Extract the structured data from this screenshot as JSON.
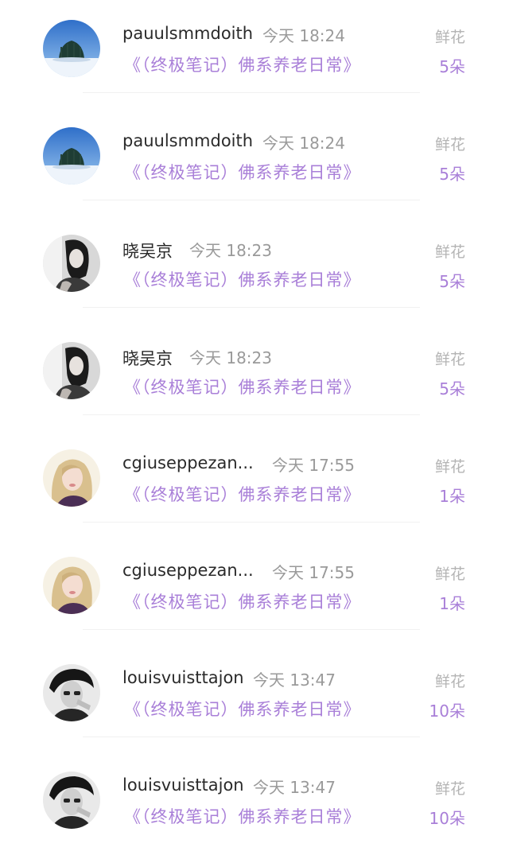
{
  "accent_color": "#a97fd8",
  "gifts": [
    {
      "user": "pauulsmmdoith",
      "time": "今天 18:24",
      "book": "《（终极笔记）佛系养老日常》",
      "gift_label": "鲜花",
      "count": "5朵",
      "avatar": "snowy-tree-avatar"
    },
    {
      "user": "pauulsmmdoith",
      "time": "今天 18:24",
      "book": "《（终极笔记）佛系养老日常》",
      "gift_label": "鲜花",
      "count": "5朵",
      "avatar": "snowy-tree-avatar"
    },
    {
      "user": "晓吴京",
      "time": "今天 18:23",
      "book": "《（终极笔记）佛系养老日常》",
      "gift_label": "鲜花",
      "count": "5朵",
      "avatar": "bw-woman-avatar"
    },
    {
      "user": "晓吴京",
      "time": "今天 18:23",
      "book": "《（终极笔记）佛系养老日常》",
      "gift_label": "鲜花",
      "count": "5朵",
      "avatar": "bw-woman-avatar"
    },
    {
      "user": "cgiuseppezan...",
      "time": "今天 17:55",
      "book": "《（终极笔记）佛系养老日常》",
      "gift_label": "鲜花",
      "count": "1朵",
      "avatar": "blonde-woman-avatar"
    },
    {
      "user": "cgiuseppezan...",
      "time": "今天 17:55",
      "book": "《（终极笔记）佛系养老日常》",
      "gift_label": "鲜花",
      "count": "1朵",
      "avatar": "blonde-woman-avatar"
    },
    {
      "user": "louisvuisttajon",
      "time": "今天 13:47",
      "book": "《（终极笔记）佛系养老日常》",
      "gift_label": "鲜花",
      "count": "10朵",
      "avatar": "bw-man-avatar"
    },
    {
      "user": "louisvuisttajon",
      "time": "今天 13:47",
      "book": "《（终极笔记）佛系养老日常》",
      "gift_label": "鲜花",
      "count": "10朵",
      "avatar": "bw-man-avatar"
    }
  ]
}
